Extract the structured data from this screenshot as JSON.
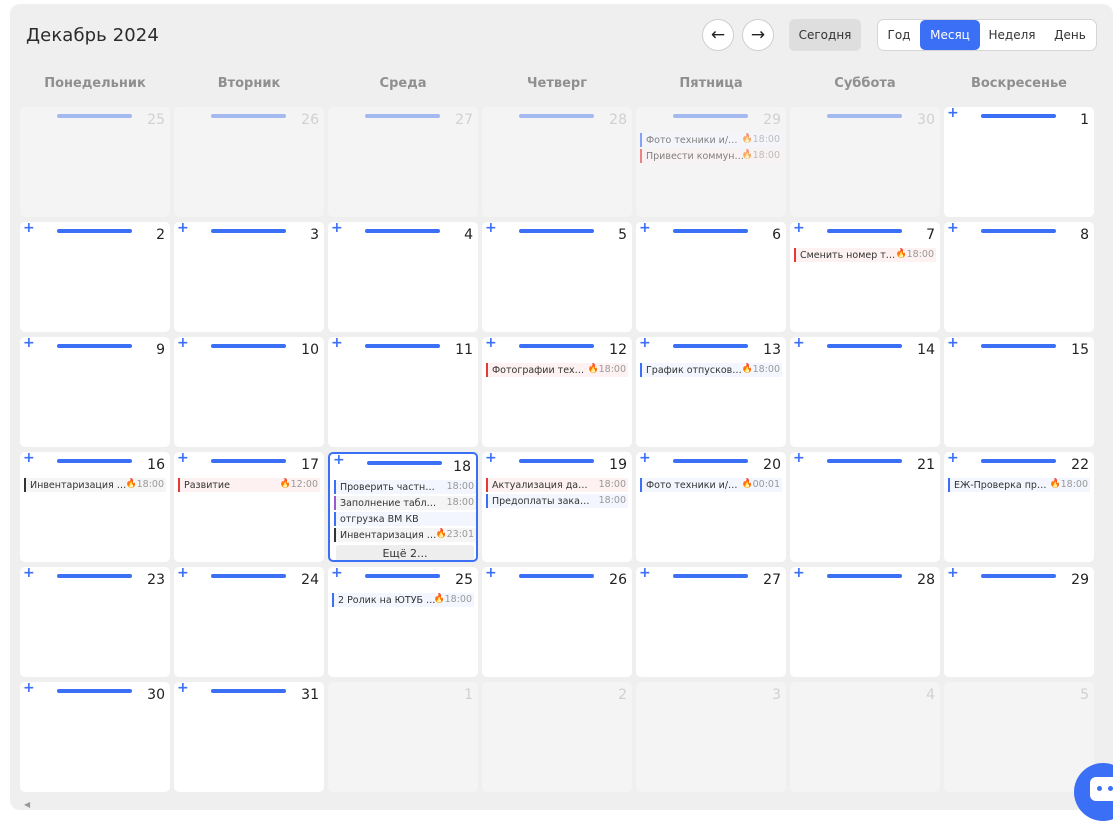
{
  "header": {
    "title": "Декабрь 2024",
    "prev_label": "←",
    "next_label": "→",
    "today_label": "Сегодня",
    "views": [
      "Год",
      "Месяц",
      "Неделя",
      "День"
    ],
    "active_view": "Месяц"
  },
  "weekdays": [
    "Понедельник",
    "Вторник",
    "Среда",
    "Четверг",
    "Пятница",
    "Суббота",
    "Воскресенье"
  ],
  "weeks": [
    [
      {
        "day": "25",
        "other": true,
        "events": []
      },
      {
        "day": "26",
        "other": true,
        "events": []
      },
      {
        "day": "27",
        "other": true,
        "events": []
      },
      {
        "day": "28",
        "other": true,
        "events": []
      },
      {
        "day": "29",
        "other": true,
        "events": [
          {
            "title": "Фото техники и/…",
            "time": "18:00",
            "fire": true,
            "color": "blue"
          },
          {
            "title": "Привести коммун…",
            "time": "18:00",
            "fire": true,
            "color": "red"
          }
        ]
      },
      {
        "day": "30",
        "other": true,
        "events": []
      },
      {
        "day": "1",
        "other": false,
        "events": []
      }
    ],
    [
      {
        "day": "2",
        "other": false,
        "events": []
      },
      {
        "day": "3",
        "other": false,
        "events": []
      },
      {
        "day": "4",
        "other": false,
        "events": []
      },
      {
        "day": "5",
        "other": false,
        "events": []
      },
      {
        "day": "6",
        "other": false,
        "events": []
      },
      {
        "day": "7",
        "other": false,
        "events": [
          {
            "title": "Сменить номер т…",
            "time": "18:00",
            "fire": true,
            "color": "red"
          }
        ]
      },
      {
        "day": "8",
        "other": false,
        "events": []
      }
    ],
    [
      {
        "day": "9",
        "other": false,
        "events": []
      },
      {
        "day": "10",
        "other": false,
        "events": []
      },
      {
        "day": "11",
        "other": false,
        "events": []
      },
      {
        "day": "12",
        "other": false,
        "events": [
          {
            "title": "Фотографии техн…",
            "time": "18:00",
            "fire": true,
            "color": "red"
          }
        ]
      },
      {
        "day": "13",
        "other": false,
        "events": [
          {
            "title": "График отпусков …",
            "time": "18:00",
            "fire": true,
            "color": "blue"
          }
        ]
      },
      {
        "day": "14",
        "other": false,
        "events": []
      },
      {
        "day": "15",
        "other": false,
        "events": []
      }
    ],
    [
      {
        "day": "16",
        "other": false,
        "events": [
          {
            "title": "Инвентаризация …",
            "time": "18:00",
            "fire": true,
            "color": "dark"
          }
        ]
      },
      {
        "day": "17",
        "other": false,
        "events": [
          {
            "title": "Развитие",
            "time": "12:00",
            "fire": true,
            "color": "red"
          }
        ]
      },
      {
        "day": "18",
        "other": false,
        "today": true,
        "more": "Ещё 2...",
        "events": [
          {
            "title": "Проверить частные …",
            "time": "18:00",
            "fire": false,
            "color": "blue"
          },
          {
            "title": "Заполнение таблиц…",
            "time": "18:00",
            "fire": false,
            "color": "purple"
          },
          {
            "title": "отгрузка ВМ КВ",
            "time": "",
            "fire": false,
            "color": "blue"
          },
          {
            "title": "Инвентаризация …",
            "time": "23:01",
            "fire": true,
            "color": "dark"
          }
        ]
      },
      {
        "day": "19",
        "other": false,
        "events": [
          {
            "title": "Актуализация данн…",
            "time": "18:00",
            "fire": false,
            "color": "red"
          },
          {
            "title": "Предоплаты заказо…",
            "time": "18:00",
            "fire": false,
            "color": "blue"
          }
        ]
      },
      {
        "day": "20",
        "other": false,
        "events": [
          {
            "title": "Фото техники и/…",
            "time": "00:01",
            "fire": true,
            "color": "blue"
          }
        ]
      },
      {
        "day": "21",
        "other": false,
        "events": []
      },
      {
        "day": "22",
        "other": false,
        "events": [
          {
            "title": "ЕЖ-Проверка пр…",
            "time": "18:00",
            "fire": true,
            "color": "blue"
          }
        ]
      }
    ],
    [
      {
        "day": "23",
        "other": false,
        "events": []
      },
      {
        "day": "24",
        "other": false,
        "events": []
      },
      {
        "day": "25",
        "other": false,
        "events": [
          {
            "title": "2 Ролик на ЮТУБ …",
            "time": "18:00",
            "fire": true,
            "color": "blue"
          }
        ]
      },
      {
        "day": "26",
        "other": false,
        "events": []
      },
      {
        "day": "27",
        "other": false,
        "events": []
      },
      {
        "day": "28",
        "other": false,
        "events": []
      },
      {
        "day": "29",
        "other": false,
        "events": []
      }
    ],
    [
      {
        "day": "30",
        "other": false,
        "events": []
      },
      {
        "day": "31",
        "other": false,
        "events": []
      },
      {
        "day": "1",
        "other": true,
        "events": []
      },
      {
        "day": "2",
        "other": true,
        "events": []
      },
      {
        "day": "3",
        "other": true,
        "events": []
      },
      {
        "day": "4",
        "other": true,
        "events": []
      },
      {
        "day": "5",
        "other": true,
        "events": []
      }
    ]
  ],
  "icons": {
    "add": "+",
    "fire": "🔥",
    "scroll_left": "◀"
  },
  "colors": {
    "accent": "#3b6ff5",
    "red": "#e53935"
  }
}
